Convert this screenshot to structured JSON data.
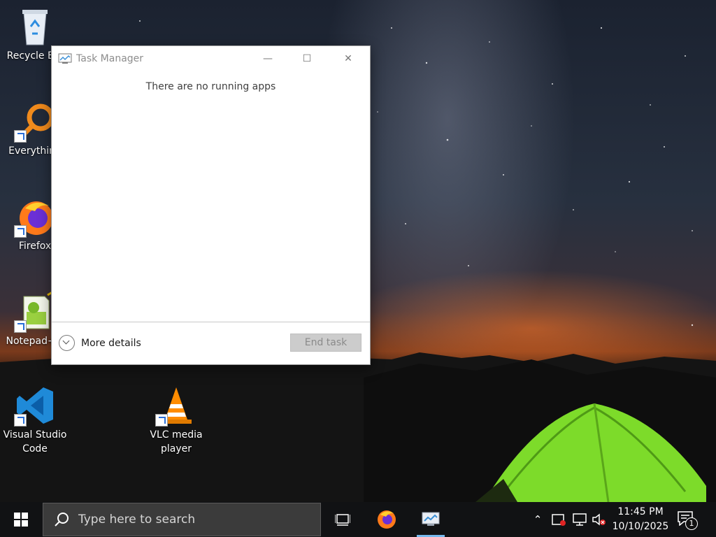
{
  "desktop": {
    "icons": [
      {
        "label": "Recycle Bin"
      },
      {
        "label": "Everything"
      },
      {
        "label": "Firefox"
      },
      {
        "label": "Notepad++"
      },
      {
        "label": "Visual Studio\nCode"
      },
      {
        "label": "VLC media\nplayer"
      }
    ]
  },
  "task_manager": {
    "title": "Task Manager",
    "message": "There are no running apps",
    "more_details_label": "More details",
    "end_task_label": "End task",
    "minimize_glyph": "—",
    "maximize_glyph": "☐",
    "close_glyph": "✕"
  },
  "taskbar": {
    "search_placeholder": "Type here to search",
    "clock_time": "11:45 PM",
    "clock_date": "10/10/2025",
    "notification_count": "1",
    "tray_chevron": "⌃"
  },
  "colors": {
    "taskbar_bg": "#111214",
    "search_bg": "#3b3b3b",
    "active_indicator": "#76b9ed",
    "tent_green": "#7ddb2a"
  }
}
